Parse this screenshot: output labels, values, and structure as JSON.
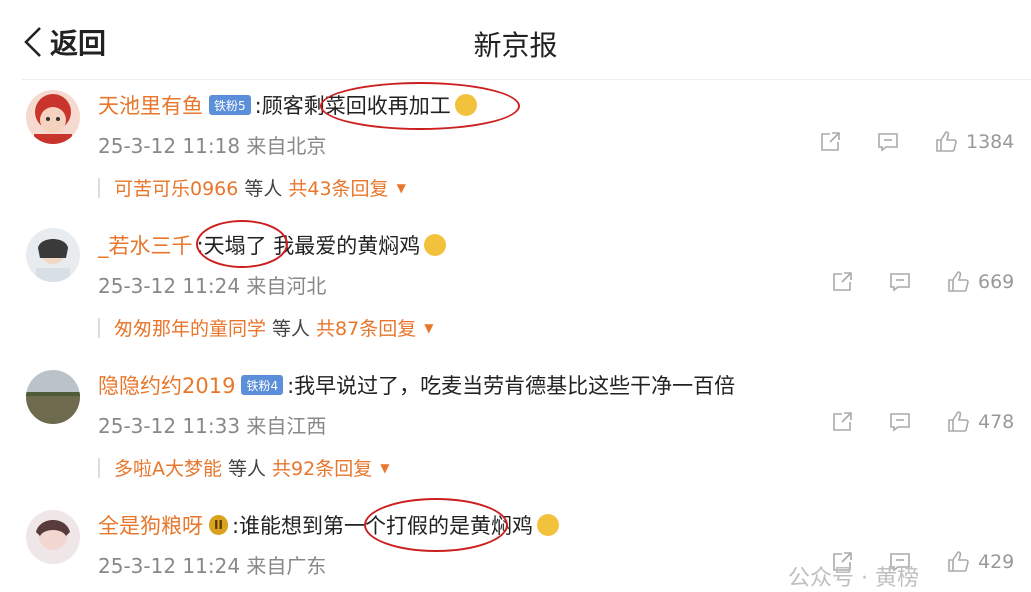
{
  "header": {
    "back_label": "返回",
    "title": "新京报"
  },
  "comments": [
    {
      "user": "天池里有鱼",
      "badge": "铁粉5",
      "badge_color": "#5b8fd9",
      "text": ":顾客剩菜回收再加工",
      "emoji": "crying-laugh-emoji",
      "meta": "25-3-12 11:18 来自北京",
      "likes": "1384",
      "reply_user": "可苦可乐0966",
      "reply_etc": "等人",
      "reply_total": "共43条回复"
    },
    {
      "user": "_若水三千",
      "text": ":天塌了 我最爱的黄焖鸡",
      "emoji": "crying-emoji",
      "meta": "25-3-12 11:24 来自河北",
      "likes": "669",
      "reply_user": "匆匆那年的童同学",
      "reply_etc": "等人",
      "reply_total": "共87条回复"
    },
    {
      "user": "隐隐约约2019",
      "badge": "铁粉4",
      "badge_color": "#5b8fd9",
      "text": ":我早说过了，吃麦当劳肯德基比这些干净一百倍",
      "meta": "25-3-12 11:33 来自江西",
      "likes": "478",
      "reply_user": "多啦A大梦能",
      "reply_etc": "等人",
      "reply_total": "共92条回复"
    },
    {
      "user": "全是狗粮呀",
      "badge": "II",
      "badge_color": "#d9a21f",
      "text": ":谁能想到第一个打假的是黄焖鸡",
      "emoji": "spit-emoji",
      "meta": "25-3-12 11:24 来自广东",
      "likes": "429"
    }
  ],
  "watermark": "公众号 · 黄榜",
  "colors": {
    "username": "#e8762b",
    "annotation_circle": "#cc1f1f"
  }
}
